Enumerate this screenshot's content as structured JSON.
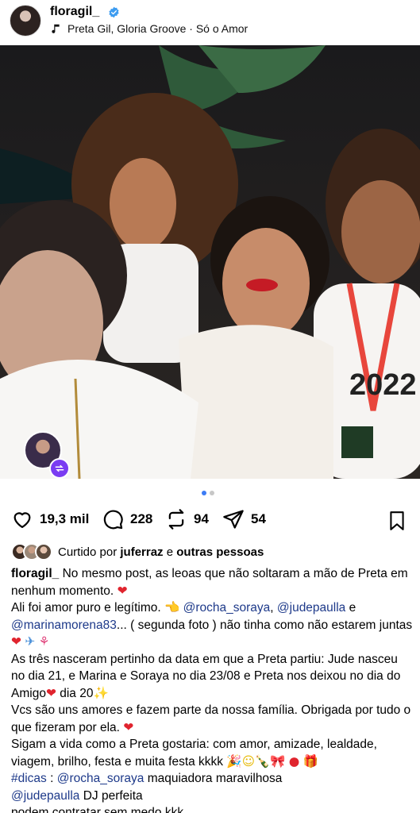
{
  "header": {
    "username": "floragil_",
    "song": "Preta Gil, Gloria Groove · Só o Amor"
  },
  "carousel": {
    "count": 2,
    "active": 1
  },
  "actions": {
    "likes": "19,3 mil",
    "comments": "228",
    "reposts": "94",
    "shares": "54"
  },
  "liked_by": {
    "prefix": "Curtido por",
    "user": "juferraz",
    "conj": "e",
    "others": "outras pessoas"
  },
  "caption": {
    "author": "floragil_",
    "l1": "No mesmo post, as leoas que não soltaram a mão de Preta em nenhum momento.",
    "l2a": "Ali foi amor puro e legítimo. ",
    "mention1": "@rocha_soraya",
    "sep1": ", ",
    "mention2": "@judepaulla",
    "sep2": " e ",
    "mention3": "@marinamorena83",
    "l2b": "... ( segunda foto ) não tinha como não estarem juntas",
    "l3": "As três nasceram pertinho da data em que a Preta partiu: Jude nasceu no dia 21, e Marina e Soraya no dia 23/08 e Preta nos deixou no dia do Amigo",
    "l3b": " dia 20",
    "l4": "Vcs são uns amores e fazem parte da nossa família. Obrigada por tudo o que fizeram por ela.",
    "l5": "Sigam a vida como a Preta gostaria: com amor, amizade, lealdade, viagem, brilho, festa  e muita festa kkkk",
    "hashtag": "#dicas",
    "l6sep": " : ",
    "mention4": "@rocha_soraya",
    "l6": " maquiadora maravilhosa",
    "mention5": "@judepaulla",
    "l7": " DJ perfeita",
    "l8": "podem contratar sem medo kkk"
  },
  "colors": {
    "verified": "#3d9cf0",
    "accent_dot": "#3d7cf5",
    "heart": "#e0242e",
    "mention": "#1e3a8a"
  },
  "icons": [
    "music-note-icon",
    "verified-badge-icon",
    "heart-icon",
    "comment-icon",
    "repost-icon",
    "share-icon",
    "bookmark-icon",
    "user-tag-icon",
    "mute-icon",
    "repost-badge-icon"
  ]
}
